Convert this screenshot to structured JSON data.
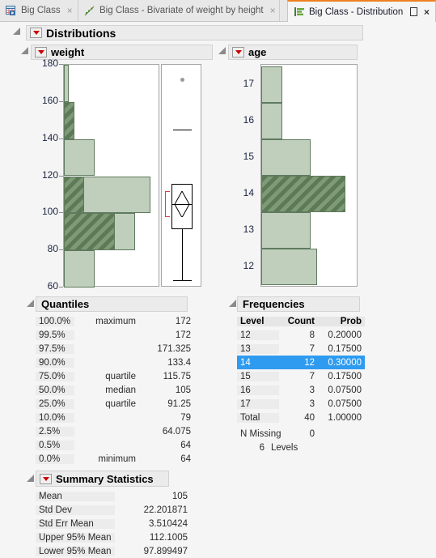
{
  "tabs": [
    {
      "label": "Big Class",
      "icon": "data-table-icon",
      "active": false,
      "close": "×"
    },
    {
      "label": "Big Class - Bivariate of weight by height",
      "icon": "bivariate-icon",
      "active": false,
      "close": "×"
    },
    {
      "label": "Big Class - Distribution",
      "icon": "distribution-icon",
      "active": true,
      "close": "×",
      "maximize": "□"
    }
  ],
  "report": {
    "title": "Distributions",
    "panels": {
      "weight": {
        "title": "weight"
      },
      "age": {
        "title": "age"
      }
    }
  },
  "colors": {
    "accent_tab": "#ef8123",
    "bar_fill": "#bfcfbc",
    "bar_selected": "#5d7a56",
    "highlight_row": "#2e9bf0",
    "red_bracket": "#d14356",
    "red_triangle": "#cc0000"
  },
  "chart_data": [
    {
      "type": "bar",
      "title": "weight",
      "orientation": "horizontal",
      "xlabel": "",
      "ylabel": "weight",
      "ylim": [
        60,
        180
      ],
      "yticks": [
        60,
        80,
        100,
        120,
        140,
        160,
        180
      ],
      "grid": false,
      "bins": [
        {
          "label": "60-80",
          "lo": 60,
          "hi": 80,
          "count": 6,
          "selected": 0
        },
        {
          "label": "80-100",
          "lo": 80,
          "hi": 100,
          "count": 14,
          "selected": 10
        },
        {
          "label": "100-120",
          "lo": 100,
          "hi": 120,
          "count": 17,
          "selected": 4
        },
        {
          "label": "120-140",
          "lo": 120,
          "hi": 140,
          "count": 6,
          "selected": 0
        },
        {
          "label": "140-160",
          "lo": 140,
          "hi": 160,
          "count": 2,
          "selected": 2
        },
        {
          "label": "160-180",
          "lo": 160,
          "hi": 180,
          "count": 1,
          "selected": 0
        }
      ],
      "boxplot": {
        "min_whisker": 64,
        "q1": 91.25,
        "median": 105,
        "q3": 115.75,
        "max_whisker": 145,
        "outliers": [
          172
        ],
        "mean": 105,
        "mean_ci_low": 97.899497,
        "mean_ci_high": 112.1005
      }
    },
    {
      "type": "bar",
      "title": "age",
      "orientation": "horizontal",
      "xlabel": "",
      "ylabel": "age",
      "ylim": [
        11.5,
        17.5
      ],
      "yticks": [
        12,
        13,
        14,
        15,
        16,
        17
      ],
      "grid": false,
      "categories": [
        17,
        16,
        15,
        14,
        13,
        12
      ],
      "values": [
        3,
        3,
        7,
        12,
        7,
        8
      ],
      "selected_category": 14
    }
  ],
  "quantiles": {
    "title": "Quantiles",
    "rows": [
      {
        "pct": "100.0%",
        "name": "maximum",
        "value": "172"
      },
      {
        "pct": "99.5%",
        "name": "",
        "value": "172"
      },
      {
        "pct": "97.5%",
        "name": "",
        "value": "171.325"
      },
      {
        "pct": "90.0%",
        "name": "",
        "value": "133.4"
      },
      {
        "pct": "75.0%",
        "name": "quartile",
        "value": "115.75"
      },
      {
        "pct": "50.0%",
        "name": "median",
        "value": "105"
      },
      {
        "pct": "25.0%",
        "name": "quartile",
        "value": "91.25"
      },
      {
        "pct": "10.0%",
        "name": "",
        "value": "79"
      },
      {
        "pct": "2.5%",
        "name": "",
        "value": "64.075"
      },
      {
        "pct": "0.5%",
        "name": "",
        "value": "64"
      },
      {
        "pct": "0.0%",
        "name": "minimum",
        "value": "64"
      }
    ]
  },
  "summary_statistics": {
    "title": "Summary Statistics",
    "rows": [
      {
        "name": "Mean",
        "value": "105"
      },
      {
        "name": "Std Dev",
        "value": "22.201871"
      },
      {
        "name": "Std Err Mean",
        "value": "3.510424"
      },
      {
        "name": "Upper 95% Mean",
        "value": "112.1005"
      },
      {
        "name": "Lower 95% Mean",
        "value": "97.899497"
      }
    ]
  },
  "frequencies": {
    "title": "Frequencies",
    "headers": [
      "Level",
      "Count",
      "Prob"
    ],
    "rows": [
      {
        "level": "12",
        "count": "8",
        "prob": "0.20000",
        "selected": false
      },
      {
        "level": "13",
        "count": "7",
        "prob": "0.17500",
        "selected": false
      },
      {
        "level": "14",
        "count": "12",
        "prob": "0.30000",
        "selected": true
      },
      {
        "level": "15",
        "count": "7",
        "prob": "0.17500",
        "selected": false
      },
      {
        "level": "16",
        "count": "3",
        "prob": "0.07500",
        "selected": false
      },
      {
        "level": "17",
        "count": "3",
        "prob": "0.07500",
        "selected": false
      },
      {
        "level": "Total",
        "count": "40",
        "prob": "1.00000",
        "selected": false
      }
    ],
    "n_missing_label": "N Missing",
    "n_missing_value": "0",
    "levels_count": "6",
    "levels_label": "Levels"
  }
}
